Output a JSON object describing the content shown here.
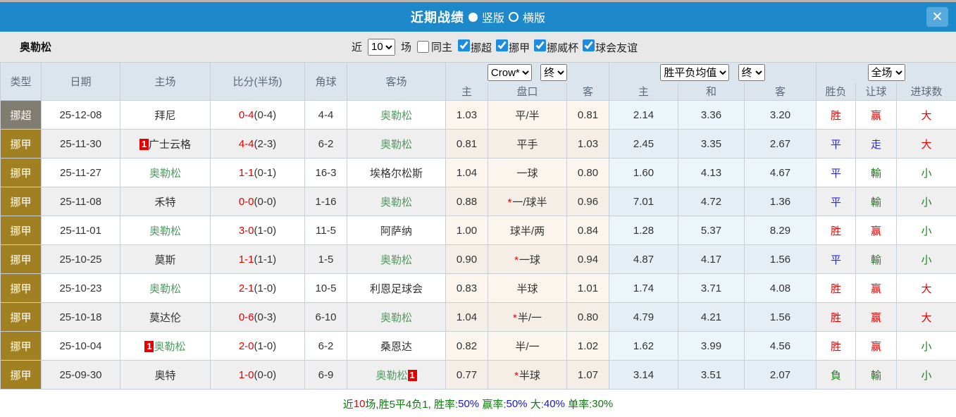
{
  "titlebar": {
    "title": "近期战绩",
    "option_vertical": "竖版",
    "option_horizontal": "横版",
    "close_label": "✕"
  },
  "filters": {
    "team": "奥勒松",
    "near_label": "近",
    "count_value": "10",
    "games_label": "场",
    "same_home_label": "同主",
    "league_labels": [
      "挪超",
      "挪甲",
      "挪威杯",
      "球会友谊"
    ]
  },
  "table": {
    "selects": {
      "bookmaker": "Crow*",
      "bookmaker_time": "终",
      "avg_type": "胜平负均值",
      "avg_time": "终",
      "scope": "全场"
    },
    "headers": {
      "type": "类型",
      "date": "日期",
      "home": "主场",
      "score": "比分(半场)",
      "corner": "角球",
      "away": "客场",
      "odds_home": "主",
      "handicap": "盘口",
      "odds_away": "客",
      "avg_home": "主",
      "avg_draw": "和",
      "avg_away": "客",
      "result_wdl": "胜负",
      "result_handicap": "让球",
      "result_goals": "进球数"
    },
    "rows": [
      {
        "league": "挪超",
        "league_class": "super",
        "date": "25-12-08",
        "home": {
          "name": "拜尼"
        },
        "score": "0-4",
        "half": "(0-4)",
        "corner": "4-4",
        "away": {
          "name": "奥勒松",
          "green": true
        },
        "odds_home": "1.03",
        "handicap": {
          "star": false,
          "text": "平/半"
        },
        "odds_away": "0.81",
        "avg": [
          "2.14",
          "3.36",
          "3.20"
        ],
        "res": [
          {
            "t": "胜",
            "c": "red"
          },
          {
            "t": "赢",
            "c": "red"
          },
          {
            "t": "大",
            "c": "red"
          }
        ]
      },
      {
        "league": "挪甲",
        "league_class": "jia",
        "date": "25-11-30",
        "home": {
          "name": "广士云格",
          "badge_before": "1"
        },
        "score": "4-4",
        "half": "(2-3)",
        "corner": "6-2",
        "away": {
          "name": "奥勒松",
          "green": true
        },
        "odds_home": "0.81",
        "handicap": {
          "star": false,
          "text": "平手"
        },
        "odds_away": "1.03",
        "avg": [
          "2.45",
          "3.35",
          "2.67"
        ],
        "res": [
          {
            "t": "平",
            "c": "blue"
          },
          {
            "t": "走",
            "c": "blue"
          },
          {
            "t": "大",
            "c": "red"
          }
        ]
      },
      {
        "league": "挪甲",
        "league_class": "jia",
        "date": "25-11-27",
        "home": {
          "name": "奥勒松",
          "green": true
        },
        "score": "1-1",
        "half": "(0-1)",
        "corner": "16-3",
        "away": {
          "name": "埃格尔松斯"
        },
        "odds_home": "1.04",
        "handicap": {
          "star": false,
          "text": "一球"
        },
        "odds_away": "0.80",
        "avg": [
          "1.60",
          "4.13",
          "4.67"
        ],
        "res": [
          {
            "t": "平",
            "c": "blue"
          },
          {
            "t": "輸",
            "c": "green"
          },
          {
            "t": "小",
            "c": "green"
          }
        ]
      },
      {
        "league": "挪甲",
        "league_class": "jia",
        "date": "25-11-08",
        "home": {
          "name": "禾特"
        },
        "score": "0-0",
        "half": "(0-0)",
        "corner": "1-16",
        "away": {
          "name": "奥勒松",
          "green": true
        },
        "odds_home": "0.88",
        "handicap": {
          "star": true,
          "text": "一/球半"
        },
        "odds_away": "0.96",
        "avg": [
          "7.01",
          "4.72",
          "1.36"
        ],
        "res": [
          {
            "t": "平",
            "c": "blue"
          },
          {
            "t": "輸",
            "c": "green"
          },
          {
            "t": "小",
            "c": "green"
          }
        ]
      },
      {
        "league": "挪甲",
        "league_class": "jia",
        "date": "25-11-01",
        "home": {
          "name": "奥勒松",
          "green": true
        },
        "score": "3-0",
        "half": "(1-0)",
        "corner": "11-5",
        "away": {
          "name": "阿萨纳"
        },
        "odds_home": "1.00",
        "handicap": {
          "star": false,
          "text": "球半/两"
        },
        "odds_away": "0.84",
        "avg": [
          "1.28",
          "5.37",
          "8.29"
        ],
        "res": [
          {
            "t": "胜",
            "c": "red"
          },
          {
            "t": "赢",
            "c": "red"
          },
          {
            "t": "小",
            "c": "green"
          }
        ]
      },
      {
        "league": "挪甲",
        "league_class": "jia",
        "date": "25-10-25",
        "home": {
          "name": "莫斯"
        },
        "score": "1-1",
        "half": "(1-1)",
        "corner": "1-5",
        "away": {
          "name": "奥勒松",
          "green": true
        },
        "odds_home": "0.90",
        "handicap": {
          "star": true,
          "text": "一球"
        },
        "odds_away": "0.94",
        "avg": [
          "4.87",
          "4.17",
          "1.56"
        ],
        "res": [
          {
            "t": "平",
            "c": "blue"
          },
          {
            "t": "輸",
            "c": "green"
          },
          {
            "t": "小",
            "c": "green"
          }
        ]
      },
      {
        "league": "挪甲",
        "league_class": "jia",
        "date": "25-10-23",
        "home": {
          "name": "奥勒松",
          "green": true
        },
        "score": "2-1",
        "half": "(1-0)",
        "corner": "10-5",
        "away": {
          "name": "利恩足球会"
        },
        "odds_home": "0.83",
        "handicap": {
          "star": false,
          "text": "半球"
        },
        "odds_away": "1.01",
        "avg": [
          "1.74",
          "3.71",
          "4.08"
        ],
        "res": [
          {
            "t": "胜",
            "c": "red"
          },
          {
            "t": "赢",
            "c": "red"
          },
          {
            "t": "大",
            "c": "red"
          }
        ]
      },
      {
        "league": "挪甲",
        "league_class": "jia",
        "date": "25-10-18",
        "home": {
          "name": "莫达伦"
        },
        "score": "0-6",
        "half": "(0-3)",
        "corner": "6-10",
        "away": {
          "name": "奥勒松",
          "green": true
        },
        "odds_home": "1.04",
        "handicap": {
          "star": true,
          "text": "半/一"
        },
        "odds_away": "0.80",
        "avg": [
          "4.79",
          "4.21",
          "1.56"
        ],
        "res": [
          {
            "t": "胜",
            "c": "red"
          },
          {
            "t": "赢",
            "c": "red"
          },
          {
            "t": "大",
            "c": "red"
          }
        ]
      },
      {
        "league": "挪甲",
        "league_class": "jia",
        "date": "25-10-04",
        "home": {
          "name": "奥勒松",
          "green": true,
          "badge_before": "1"
        },
        "score": "2-0",
        "half": "(1-0)",
        "corner": "6-2",
        "away": {
          "name": "桑恩达"
        },
        "odds_home": "0.82",
        "handicap": {
          "star": false,
          "text": "半/一"
        },
        "odds_away": "1.02",
        "avg": [
          "1.62",
          "3.99",
          "4.56"
        ],
        "res": [
          {
            "t": "胜",
            "c": "red"
          },
          {
            "t": "赢",
            "c": "red"
          },
          {
            "t": "小",
            "c": "green"
          }
        ]
      },
      {
        "league": "挪甲",
        "league_class": "jia",
        "date": "25-09-30",
        "home": {
          "name": "奥特"
        },
        "score": "1-0",
        "half": "(0-0)",
        "corner": "6-9",
        "away": {
          "name": "奥勒松",
          "green": true,
          "badge_after": "1"
        },
        "odds_home": "0.77",
        "handicap": {
          "star": true,
          "text": "半球"
        },
        "odds_away": "1.07",
        "avg": [
          "3.14",
          "3.51",
          "2.07"
        ],
        "res": [
          {
            "t": "負",
            "c": "green"
          },
          {
            "t": "輸",
            "c": "green"
          },
          {
            "t": "小",
            "c": "green"
          }
        ]
      }
    ]
  },
  "summary": {
    "segments": [
      {
        "text": "近",
        "color": "green"
      },
      {
        "text": "10",
        "color": "red"
      },
      {
        "text": "场,胜5平4负1, ",
        "color": "green"
      },
      {
        "text": "胜率:",
        "color": "green"
      },
      {
        "text": "50%",
        "color": "blue"
      },
      {
        "text": " 赢率:",
        "color": "green"
      },
      {
        "text": "50%",
        "color": "blue"
      },
      {
        "text": " 大:",
        "color": "green"
      },
      {
        "text": "40%",
        "color": "blue"
      },
      {
        "text": " 单率:",
        "color": "green"
      },
      {
        "text": "30%",
        "color": "green"
      }
    ]
  },
  "colors": {
    "titlebar_bg": "#1d89cb",
    "close_bg": "#55a9dd",
    "filter_bg": "#e8e8e8",
    "header_bg": "#dce5ee",
    "type_super_bg": "#807c6f",
    "type_jia_bg": "#a08020",
    "win_red": "#e60000",
    "draw_blue": "#2b2bcc",
    "lose_green": "#1e821e",
    "team_green": "#4f9c60"
  }
}
